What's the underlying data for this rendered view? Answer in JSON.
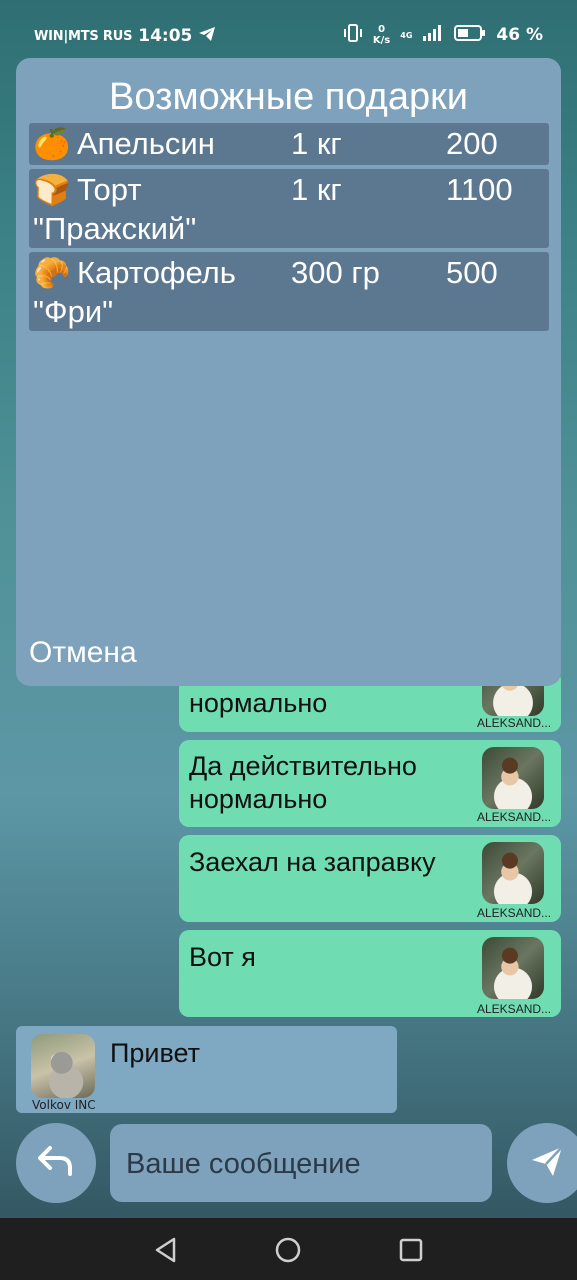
{
  "status_bar": {
    "carrier": "WIN|MTS RUS",
    "time": "14:05",
    "speed_value": "0",
    "speed_unit": "K/s",
    "network": "4G",
    "battery": "46 %"
  },
  "dialog": {
    "title": "Возможные подарки",
    "items": [
      {
        "emoji": "🍊",
        "name": "Апельсин",
        "qty": "1 кг",
        "price": "200"
      },
      {
        "emoji": "🍞",
        "name": "Торт \"Пражский\"",
        "qty": "1 кг",
        "price": "1100"
      },
      {
        "emoji": "🥐",
        "name": "Картофель \"Фри\"",
        "qty": "300 гр",
        "price": "500"
      }
    ],
    "cancel_label": "Отмена"
  },
  "messages": [
    {
      "text": "нормально",
      "sender": "ALEKSAND..."
    },
    {
      "text": "Да действительно нормально",
      "sender": "ALEKSAND..."
    },
    {
      "text": "Заехал на заправку",
      "sender": "ALEKSAND..."
    },
    {
      "text": "Вот я",
      "sender": "ALEKSAND..."
    }
  ],
  "incoming": {
    "text": "Привет",
    "sender": "Volkov INC"
  },
  "input": {
    "placeholder": "Ваше сообщение"
  },
  "colors": {
    "outgoing_bubble": "#6fdcb1",
    "panel": "#7ea2bb",
    "row": "#5b7890"
  }
}
